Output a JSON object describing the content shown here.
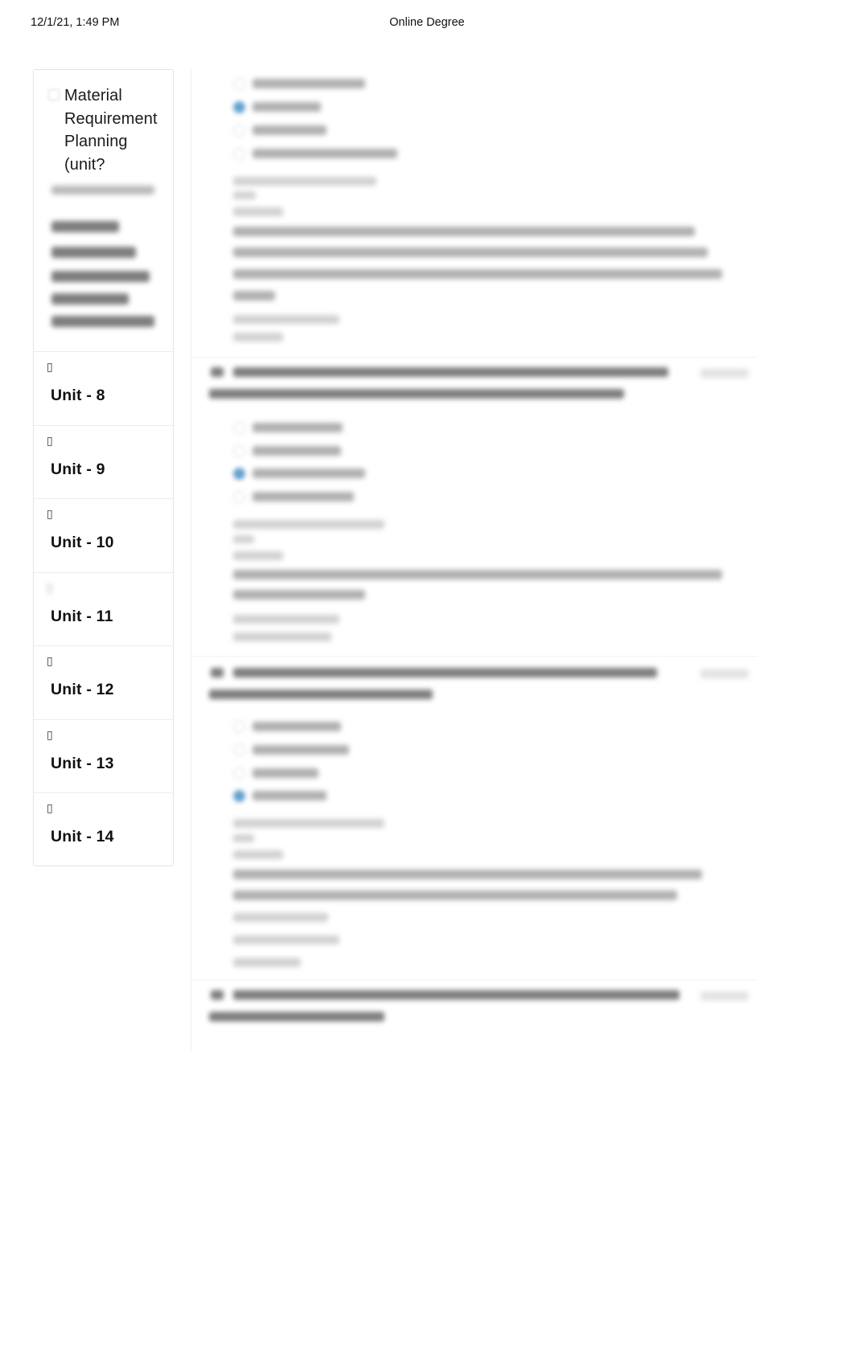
{
  "print_header": {
    "date": "12/1/21, 1:49 PM",
    "site_title": "Online Degree"
  },
  "sidebar": {
    "title": "Material Requirement Planning (unit?",
    "checkbox_icon": "checkbox-icon",
    "blurred_subtitle_note": "blurred-course-subtitle",
    "blurred_nav_note": "blurred-nav-links",
    "items": [
      {
        "icon": "missing-glyph-icon",
        "label": "Unit - 8",
        "icon_blurred": false
      },
      {
        "icon": "missing-glyph-icon",
        "label": "Unit - 9",
        "icon_blurred": false
      },
      {
        "icon": "missing-glyph-icon",
        "label": "Unit - 10",
        "icon_blurred": false
      },
      {
        "icon": "missing-glyph-icon",
        "label": "Unit - 11",
        "icon_blurred": true
      },
      {
        "icon": "missing-glyph-icon",
        "label": "Unit - 12",
        "icon_blurred": false
      },
      {
        "icon": "missing-glyph-icon",
        "label": "Unit - 13",
        "icon_blurred": false
      },
      {
        "icon": "missing-glyph-icon",
        "label": "Unit - 14",
        "icon_blurred": false
      }
    ],
    "glyph": "▯"
  },
  "content": {
    "note": "quiz-questions-blurred",
    "selected_radio_color": "#5b9ccd",
    "unselected_radio_color": "#cfcfcf",
    "mark_label_note": "1 mark (blurred)",
    "questions": [
      {
        "options": 4,
        "selected_index": 1,
        "has_mark_label": false
      },
      {
        "options": 4,
        "selected_index": 2,
        "has_mark_label": true
      },
      {
        "options": 4,
        "selected_index": 3,
        "has_mark_label": true
      },
      {
        "options": 0,
        "selected_index": -1,
        "has_mark_label": true
      }
    ]
  }
}
